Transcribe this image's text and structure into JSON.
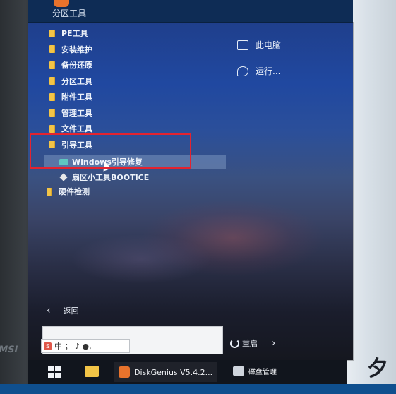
{
  "window": {
    "top_title": "分区工具"
  },
  "folders": [
    {
      "label": "PE工具"
    },
    {
      "label": "安装维护"
    },
    {
      "label": "备份还原"
    },
    {
      "label": "分区工具"
    },
    {
      "label": "附件工具"
    },
    {
      "label": "管理工具"
    },
    {
      "label": "文件工具"
    },
    {
      "label": "引导工具"
    }
  ],
  "boot_tools_items": [
    {
      "label": "Windows引导修复"
    },
    {
      "label": "扇区小工具BOOTICE"
    }
  ],
  "extra_folder": {
    "label": "硬件检测"
  },
  "right_column": {
    "this_pc": "此电脑",
    "run": "运行..."
  },
  "back_label": "返回",
  "search": {
    "placeholder": ""
  },
  "ime_bar": {
    "text": "中 ； ♪ ●,  "
  },
  "restart_label": "重启",
  "taskbar": {
    "diskgenius_label": "DiskGenius V5.4.2...",
    "disk_mgmt_label": "磁盘管理"
  },
  "overlay_text": "夕"
}
